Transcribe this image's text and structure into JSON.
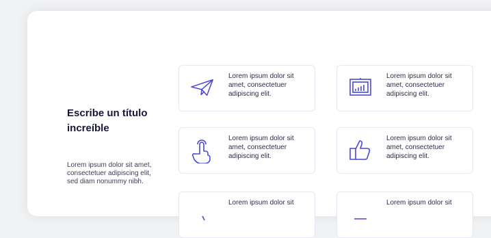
{
  "section": {
    "title": "Escribe un título increíble",
    "description": "Lorem ipsum dolor sit amet, consectetuer adipiscing elit, sed diam nonummy nibh."
  },
  "features": [
    {
      "icon": "paper-plane-icon",
      "text": "Lorem ipsum dolor sit amet, consectetuer adipiscing elit."
    },
    {
      "icon": "presentation-chart-icon",
      "text": "Lorem ipsum dolor sit amet, consectetuer adipiscing elit."
    },
    {
      "icon": "tap-hand-icon",
      "text": "Lorem ipsum dolor sit amet, consectetuer adipiscing elit."
    },
    {
      "icon": "thumbs-up-icon",
      "text": "Lorem ipsum dolor sit amet, consectetuer adipiscing elit."
    },
    {
      "icon": "feature-icon",
      "text": "Lorem ipsum dolor sit"
    },
    {
      "icon": "feature-icon",
      "text": "Lorem ipsum dolor sit"
    }
  ],
  "colors": {
    "accent": "#4a47d6",
    "title": "#16163a",
    "border": "#e6e7f2"
  }
}
